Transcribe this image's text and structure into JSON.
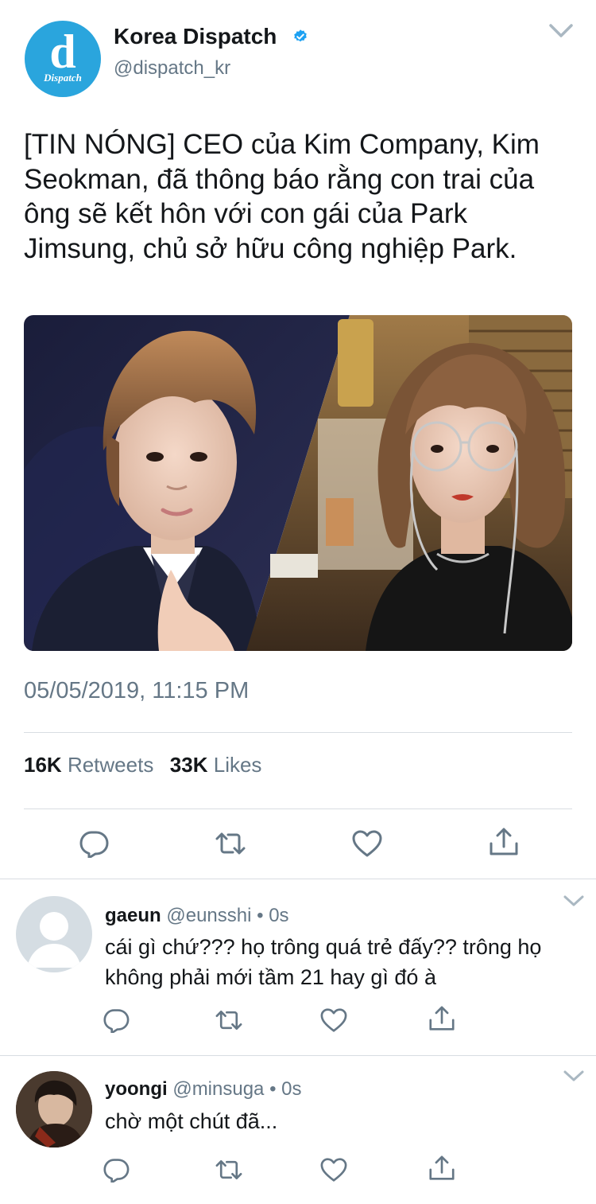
{
  "tweet": {
    "author": {
      "display_name": "Korea Dispatch",
      "handle": "@dispatch_kr",
      "verified": true,
      "avatar_logo_letter": "d",
      "avatar_logo_word": "Dispatch",
      "avatar_color": "#2aa5dd"
    },
    "text": "[TIN NÓNG] CEO của Kim Company, Kim Seokman, đã thông báo rằng con trai của ông sẽ kết hôn với con gái của Park Jimsung, chủ sở hữu công nghiệp Park.",
    "timestamp": "05/05/2019, 11:15 PM",
    "stats": {
      "retweets_count": "16K",
      "retweets_label": "Retweets",
      "likes_count": "33K",
      "likes_label": "Likes"
    },
    "actions": [
      "reply-icon",
      "retweet-icon",
      "like-icon",
      "share-icon"
    ]
  },
  "replies": [
    {
      "name": "gaeun",
      "handle": "@eunsshi",
      "time": "• 0s",
      "text": "cái gì chứ??? họ trông quá trẻ đấy?? trông họ không phải mới tầm 21 hay gì đó à",
      "avatar": "default-avatar"
    },
    {
      "name": "yoongi",
      "handle": "@minsuga",
      "time": "• 0s",
      "text": "chờ một chút đã...",
      "avatar": "photo-avatar"
    }
  ],
  "colors": {
    "text": "#14171a",
    "secondary": "#657786",
    "divider": "#d8dde2",
    "verified": "#1da1f2"
  }
}
